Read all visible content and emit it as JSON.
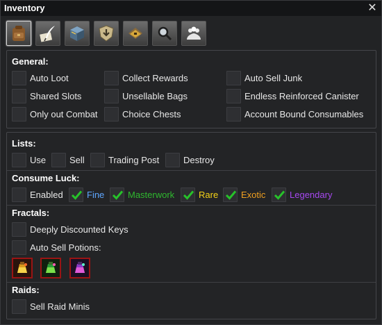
{
  "window": {
    "title": "Inventory",
    "close_icon": "close-icon"
  },
  "tabs": [
    {
      "icon": "backpack-icon",
      "active": true
    },
    {
      "icon": "quill-icon",
      "active": false
    },
    {
      "icon": "crate-icon",
      "active": false
    },
    {
      "icon": "shield-download-icon",
      "active": false
    },
    {
      "icon": "treasure-chest-icon",
      "active": false
    },
    {
      "icon": "magnifier-icon",
      "active": false
    },
    {
      "icon": "people-icon",
      "active": false
    }
  ],
  "general": {
    "title": "General:",
    "options": [
      {
        "label": "Auto Loot",
        "checked": false
      },
      {
        "label": "Collect Rewards",
        "checked": false
      },
      {
        "label": "Auto Sell Junk",
        "checked": false
      },
      {
        "label": "Shared Slots",
        "checked": false
      },
      {
        "label": "Unsellable Bags",
        "checked": false
      },
      {
        "label": "Endless Reinforced Canister",
        "checked": false
      },
      {
        "label": "Only out Combat",
        "checked": false
      },
      {
        "label": "Choice Chests",
        "checked": false
      },
      {
        "label": "Account Bound Consumables",
        "checked": false
      }
    ]
  },
  "lists": {
    "title": "Lists:",
    "options": [
      {
        "label": "Use",
        "checked": false
      },
      {
        "label": "Sell",
        "checked": false
      },
      {
        "label": "Trading Post",
        "checked": false
      },
      {
        "label": "Destroy",
        "checked": false
      }
    ]
  },
  "consume_luck": {
    "title": "Consume Luck:",
    "options": [
      {
        "label": "Enabled",
        "checked": false,
        "color": "#e8e8e8"
      },
      {
        "label": "Fine",
        "checked": true,
        "color": "#5ea6ff"
      },
      {
        "label": "Masterwork",
        "checked": true,
        "color": "#2fb82f"
      },
      {
        "label": "Rare",
        "checked": true,
        "color": "#f5d317"
      },
      {
        "label": "Exotic",
        "checked": true,
        "color": "#f0a020"
      },
      {
        "label": "Legendary",
        "checked": true,
        "color": "#a648f0"
      }
    ]
  },
  "fractals": {
    "title": "Fractals:",
    "options": [
      {
        "label": "Deeply Discounted Keys",
        "checked": false
      },
      {
        "label": "Auto Sell Potions:",
        "checked": false
      }
    ],
    "potions": [
      {
        "icon": "potion-gold-icon"
      },
      {
        "icon": "potion-green-icon"
      },
      {
        "icon": "potion-purple-icon"
      }
    ]
  },
  "raids": {
    "title": "Raids:",
    "options": [
      {
        "label": "Sell Raid Minis",
        "checked": false
      }
    ]
  },
  "colors": {
    "check_green": "#27c22a",
    "potion_border": "#9a1414"
  }
}
